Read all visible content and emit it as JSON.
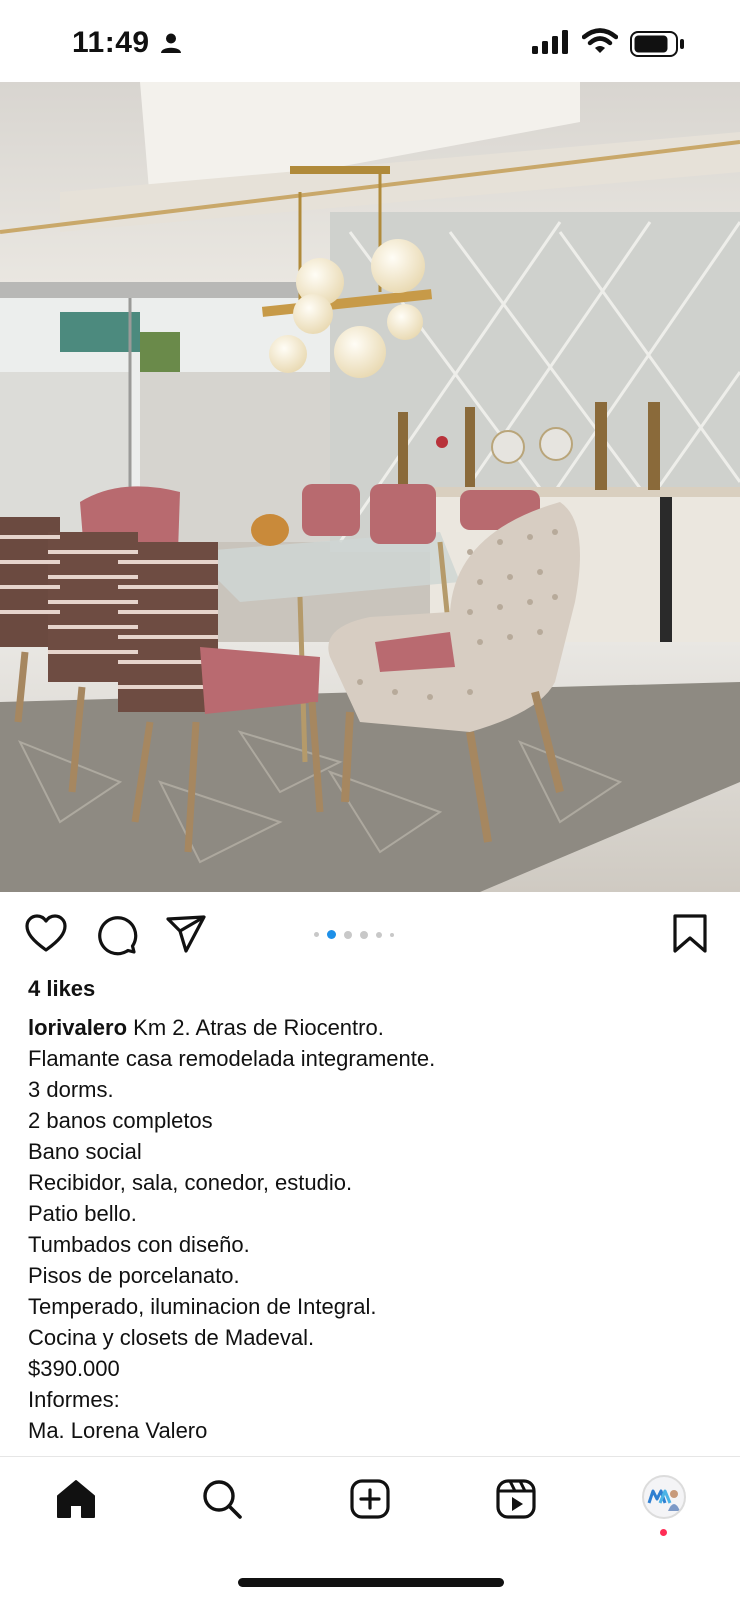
{
  "status_bar": {
    "time": "11:49",
    "icons": [
      "person-icon",
      "signal-icon",
      "wifi-icon",
      "battery-icon"
    ]
  },
  "post": {
    "image_description_icon": "photo",
    "carousel": {
      "count": 6,
      "active_index": 1
    },
    "actions": [
      "heart-icon",
      "comment-icon",
      "share-icon",
      "bookmark-icon"
    ],
    "likes": "4 likes",
    "username": "lorivalero",
    "caption_first": " Km 2. Atras de Riocentro.",
    "caption_lines": [
      "Flamante casa remodelada integramente.",
      "3 dorms.",
      "2 banos completos",
      "Bano social",
      "Recibidor, sala, conedor, estudio.",
      "Patio bello.",
      "Tumbados con diseño.",
      "Pisos de porcelanato.",
      "Temperado, iluminacion de Integral.",
      "Cocina y closets de Madeval.",
      "$390.000",
      "Informes:",
      "Ma. Lorena Valero"
    ]
  },
  "bottom_nav": {
    "items": [
      "home-icon",
      "search-icon",
      "create-icon",
      "reels-icon",
      "profile-avatar"
    ],
    "active": "home-icon",
    "accent_color": "#ff2d55"
  }
}
